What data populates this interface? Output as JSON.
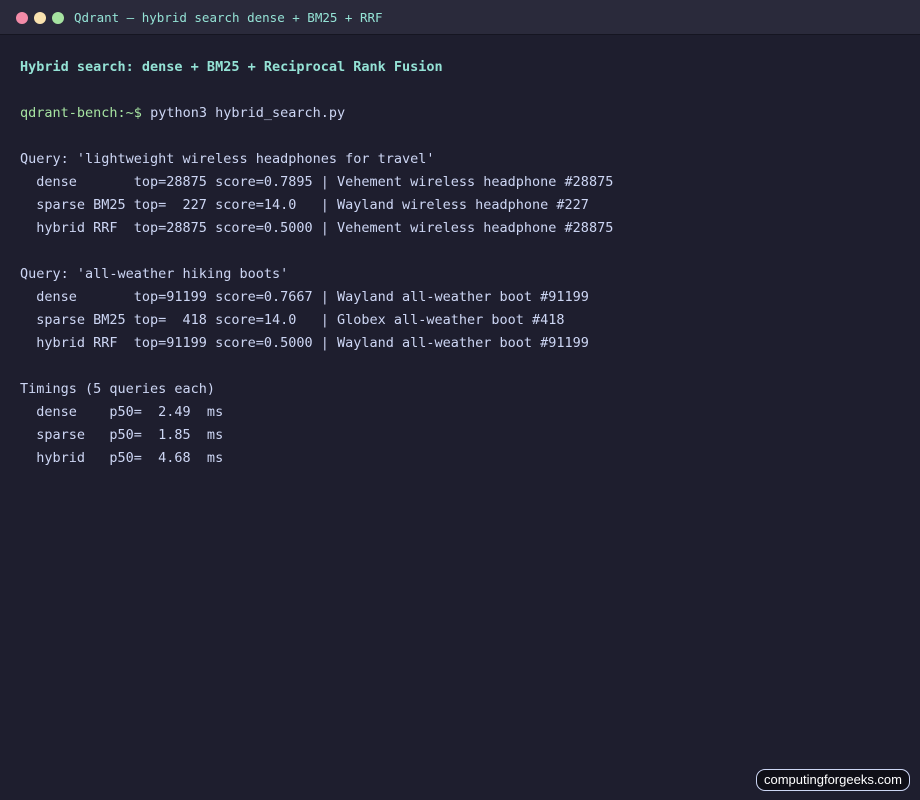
{
  "window": {
    "title": "Qdrant — hybrid search dense + BM25 + RRF",
    "controls": [
      "close",
      "minimize",
      "maximize"
    ]
  },
  "terminal": {
    "heading": "Hybrid search: dense + BM25 + Reciprocal Rank Fusion",
    "prompt": "qdrant-bench:~$",
    "command": "python3 hybrid_search.py",
    "lines": {
      "q1_header": "Query: 'lightweight wireless headphones for travel'",
      "q1_dense": "  dense       top=28875 score=0.7895 | Vehement wireless headphone #28875",
      "q1_sparse": "  sparse BM25 top=  227 score=14.0   | Wayland wireless headphone #227",
      "q1_hybrid": "  hybrid RRF  top=28875 score=0.5000 | Vehement wireless headphone #28875",
      "q2_header": "Query: 'all-weather hiking boots'",
      "q2_dense": "  dense       top=91199 score=0.7667 | Wayland all-weather boot #91199",
      "q2_sparse": "  sparse BM25 top=  418 score=14.0   | Globex all-weather boot #418",
      "q2_hybrid": "  hybrid RRF  top=91199 score=0.5000 | Wayland all-weather boot #91199",
      "timings_header": "Timings (5 queries each)",
      "t_dense": "  dense    p50=  2.49  ms",
      "t_sparse": "  sparse   p50=  1.85  ms",
      "t_hybrid": "  hybrid   p50=  4.68  ms"
    }
  },
  "watermark": "computingforgeeks.com",
  "colors": {
    "background": "#1e1e2e",
    "titlebar": "#2a2a3b",
    "accent": "#94e2d5",
    "prompt": "#a6e3a1",
    "text": "#cdd6f4",
    "close": "#f38ba8",
    "minimize": "#f9e2af",
    "maximize": "#a6e3a1"
  }
}
